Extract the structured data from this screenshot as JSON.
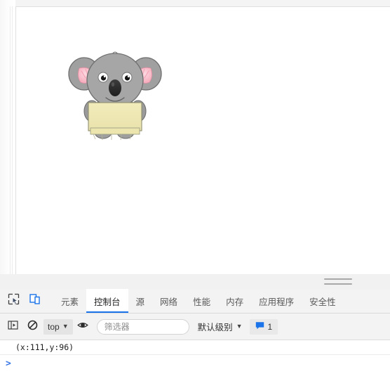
{
  "window": {
    "title": "DevTools Console"
  },
  "viewport": {
    "illustration_name": "koala-holding-blank-sign",
    "colors": {
      "koala_body": "#9a9a9a",
      "koala_face": "#a5a5a5",
      "koala_outline": "#6f6f6f",
      "ear_inner": "#f7afbe",
      "ear_inner_light": "#fcd6de",
      "nose": "#2b2b2b",
      "sign_fill": "#efeab7",
      "sign_outline": "#8f8f6f",
      "page_background": "#ffffff"
    }
  },
  "drawer": {
    "resize_handle_name": "drawer-resize-handle"
  },
  "devtools": {
    "toolbar_icons": [
      {
        "name": "inspect-element-icon",
        "title": ""
      },
      {
        "name": "device-toolbar-icon",
        "title": ""
      }
    ],
    "tabs": [
      {
        "label": "元素",
        "active": false
      },
      {
        "label": "控制台",
        "active": true
      },
      {
        "label": "源",
        "active": false
      },
      {
        "label": "网络",
        "active": false
      },
      {
        "label": "性能",
        "active": false
      },
      {
        "label": "内存",
        "active": false
      },
      {
        "label": "应用程序",
        "active": false
      },
      {
        "label": "安全性",
        "active": false
      }
    ],
    "accent_color": "#1a73e8"
  },
  "console": {
    "toolbar": {
      "sidebar_toggle_name": "console-sidebar-toggle",
      "clear_button_name": "clear-console-button",
      "context_value": "top",
      "live_expression_icon": "eye-icon",
      "filter_placeholder": "筛选器",
      "filter_value": "",
      "level_label": "默认级别",
      "message_count": "1",
      "message_badge_icon": "message-bubble-icon"
    },
    "messages": [
      {
        "text": "(x:111,y:96)",
        "level": "log"
      }
    ],
    "prompt_symbol": ">",
    "prompt_value": ""
  }
}
